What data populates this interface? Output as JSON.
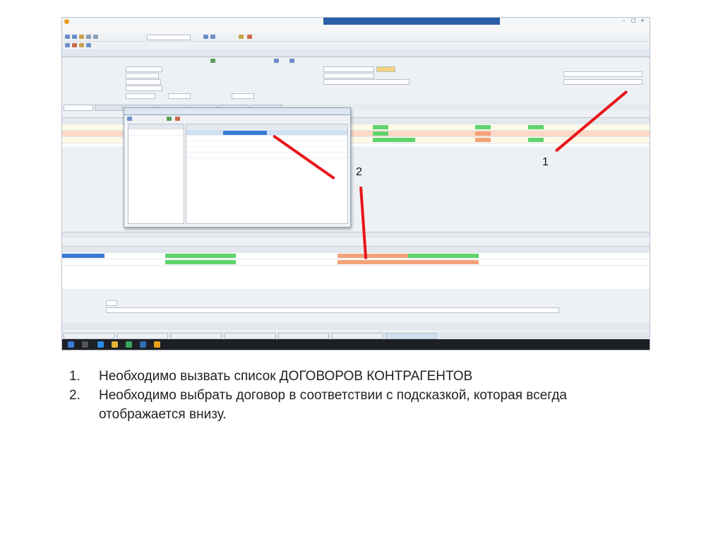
{
  "callouts": {
    "one": "1",
    "two": "2"
  },
  "instructions": [
    {
      "number": "1.",
      "text": "Необходимо вызвать список ДОГОВОРОВ КОНТРАГЕНТОВ"
    },
    {
      "number": "2.",
      "text": "Необходимо выбрать договор в соответствии с подсказкой, которая всегда отображается внизу."
    }
  ],
  "colors": {
    "arrow": "#e8141b",
    "green_cell": "#5fd36e",
    "orange_cell": "#f4a27a",
    "taskbar": "#1d1f24",
    "selection": "#3b7ad6"
  }
}
